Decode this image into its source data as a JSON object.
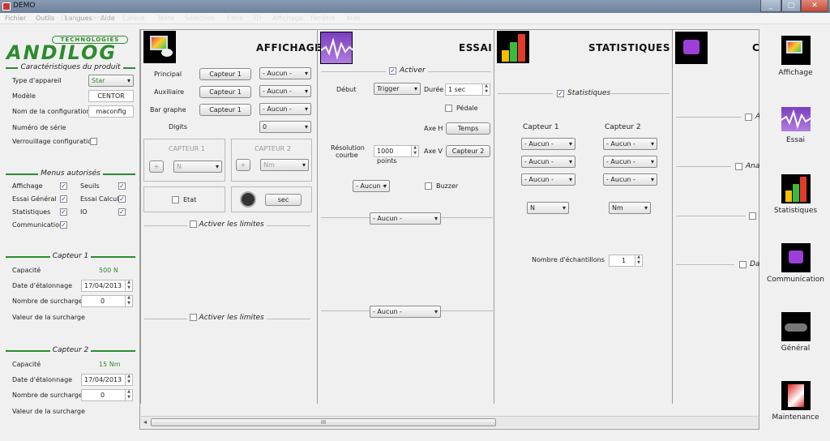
{
  "window": {
    "title": "DEMO",
    "min": "_",
    "max": "□",
    "close": "✕"
  },
  "menu": [
    "Fichier",
    "Outils",
    "Langues",
    "Aide"
  ],
  "menu_faded": [
    "Fichier",
    "Outils",
    "Image",
    "Calque",
    "Texte",
    "Sélection",
    "Filtre",
    "3D",
    "Affichage",
    "Fenêtre",
    "Aide"
  ],
  "left": {
    "logo_top": "TECHNOLOGIES",
    "logo": "ANDILOG",
    "produit_title": "Caractéristiques du produit",
    "type_label": "Type d'appareil",
    "type_value": "Star",
    "modele_label": "Modèle",
    "modele_value": "CENTOR",
    "config_label": "Nom de la configuration",
    "config_value": "maconfig",
    "serie_label": "Numéro de série",
    "verrou_label": "Verrouillage configuration",
    "menus_title": "Menus autorisés",
    "m_affichage": "Affichage",
    "m_seuils": "Seuils",
    "m_essai": "Essai Général",
    "m_calcul": "Essai Calcul",
    "m_stats": "Statistiques",
    "m_io": "IO",
    "m_comm": "Communication",
    "c1_title": "Capteur 1",
    "c1_cap_label": "Capacité",
    "c1_cap": "500 N",
    "c1_date_label": "Date d'étalonnage",
    "c1_date": "17/04/2013",
    "c1_surch_label": "Nombre de surcharges",
    "c1_surch": "0",
    "c1_val_label": "Valeur de la surcharge",
    "c2_title": "Capteur 2",
    "c2_cap_label": "Capacité",
    "c2_cap": "15 Nm",
    "c2_date_label": "Date d'étalonnage",
    "c2_date": "17/04/2013",
    "c2_surch_label": "Nombre de surcharges",
    "c2_surch": "0",
    "c2_val_label": "Valeur de la surcharge"
  },
  "affichage": {
    "title": "AFFICHAGE",
    "principal": "Principal",
    "auxiliaire": "Auxiliaire",
    "bargraphe": "Bar graphe",
    "digits": "Digits",
    "capteur1": "Capteur 1",
    "aucun": "- Aucun -",
    "digits_val": "0",
    "cap1_hdr": "CAPTEUR 1",
    "cap2_hdr": "CAPTEUR 2",
    "plus": "+",
    "unit1": "N",
    "unit2": "Nm",
    "etat": "Etat",
    "sec": "sec",
    "limites": "Activer les limites"
  },
  "essai": {
    "title": "ESSAI",
    "activer": "Activer",
    "debut": "Début",
    "trigger": "Trigger",
    "duree": "Durée",
    "duree_val": "1 sec",
    "pedale": "Pédale",
    "axeh": "Axe H",
    "temps": "Temps",
    "resol": "Résolution",
    "courbe": "courbe",
    "points": "1000 points",
    "axev": "Axe V",
    "capteur2": "Capteur 2",
    "aucun": "- Aucun -",
    "buzzer": "Buzzer"
  },
  "stats": {
    "title": "STATISTIQUES",
    "stats_cb": "Statistiques",
    "cap1": "Capteur 1",
    "cap2": "Capteur 2",
    "aucun": "- Aucun -",
    "unit1": "N",
    "unit2": "Nm",
    "nb_label": "Nombre d'échantillons",
    "nb_val": "1"
  },
  "p5": {
    "title": "C",
    "a": "A",
    "ana": "Ana",
    "da": "Da"
  },
  "sidebar": [
    "Affichage",
    "Essai",
    "Statistiques",
    "Communication",
    "Général",
    "Maintenance"
  ],
  "scroll": {
    "grip": "III",
    "left": "◂",
    "right": "▸"
  }
}
